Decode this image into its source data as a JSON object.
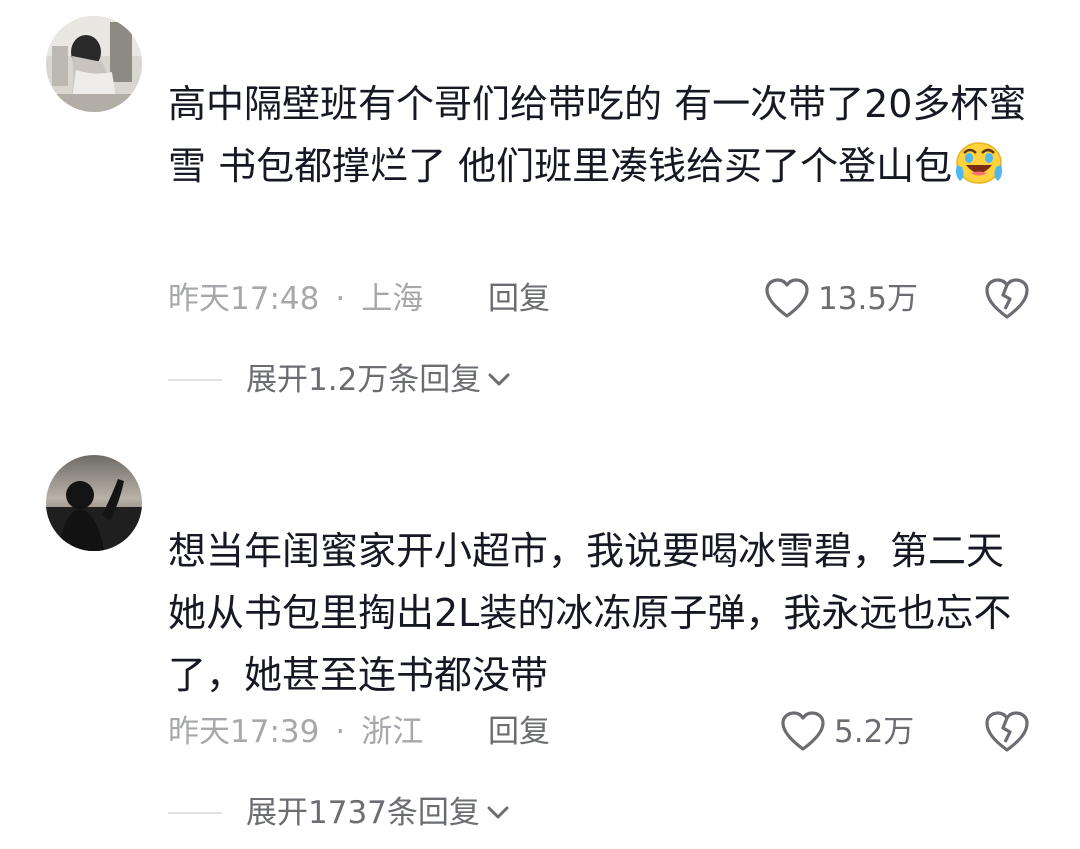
{
  "comments": [
    {
      "text": "高中隔壁班有个哥们给带吃的 有一次带了20多杯蜜雪 书包都撑烂了 他们班里凑钱给买了个登山包",
      "emoji": "laugh-cry-emoji",
      "time": "昨天17:48",
      "separator": "·",
      "location": "上海",
      "reply_label": "回复",
      "like_count": "13.5万",
      "expand_label": "展开1.2万条回复"
    },
    {
      "text": "想当年闺蜜家开小超市，我说要喝冰雪碧，第二天她从书包里掏出2L装的冰冻原子弹，我永远也忘不了，她甚至连书都没带",
      "time": "昨天17:39",
      "separator": "·",
      "location": "浙江",
      "reply_label": "回复",
      "like_count": "5.2万",
      "expand_label": "展开1737条回复"
    }
  ],
  "icons": {
    "like": "heart-outline-icon",
    "dislike": "broken-heart-icon",
    "expand": "chevron-down-icon"
  },
  "colors": {
    "text": "#161823",
    "meta": "#a7a8ab",
    "action": "#6b6d72",
    "divider": "#e1e1e3"
  }
}
